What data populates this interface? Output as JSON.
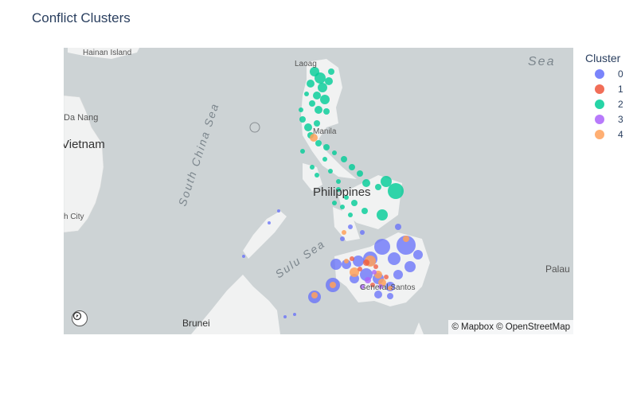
{
  "title": "Conflict Clusters",
  "map": {
    "labels": {
      "hainan": "Hainan Island",
      "sea_top": "Sea",
      "laoag": "Laoag",
      "da_nang": "Da Nang",
      "vietnam": "Vietnam",
      "south_china_sea": "South China Sea",
      "philippines": "Philippines",
      "manila": "Manila",
      "hcm_city": "h City",
      "sulu_sea": "Sulu Sea",
      "palau": "Palau",
      "general_santos": "General Santos",
      "brunei": "Brunei"
    },
    "attribution": "© Mapbox © OpenStreetMap",
    "logo_icon": "mapbox-logo-icon"
  },
  "legend": {
    "title": "Cluster",
    "items": [
      {
        "label": "0",
        "color": "#636efa"
      },
      {
        "label": "1",
        "color": "#ef553b"
      },
      {
        "label": "2",
        "color": "#00cc96"
      },
      {
        "label": "3",
        "color": "#ab63fa"
      },
      {
        "label": "4",
        "color": "#ffa15a"
      }
    ]
  },
  "colors": {
    "water": "#cdd3d5",
    "land": "#f1f2f2",
    "title": "#2a3f5f"
  }
}
